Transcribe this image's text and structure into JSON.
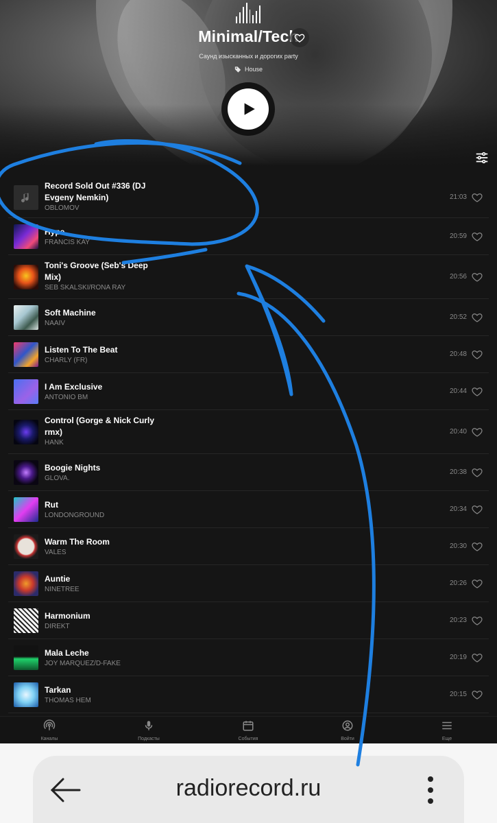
{
  "channel": {
    "title": "Minimal/Tech",
    "subtitle": "Саунд изысканных и дорогих party",
    "genre": "House"
  },
  "tracks": [
    {
      "title": "Record Sold Out #336 (DJ Evgeny Nemkin)",
      "artist": "Oblomov",
      "time": "21:03"
    },
    {
      "title": "Hype",
      "artist": "FRANCIS KAY",
      "time": "20:59"
    },
    {
      "title": "Toni's Groove (Seb's Deep Mix)",
      "artist": "SEB SKALSKI/RONA RAY",
      "time": "20:56"
    },
    {
      "title": "Soft Machine",
      "artist": "NAAIV",
      "time": "20:52"
    },
    {
      "title": "Listen To The Beat",
      "artist": "CHARLY (FR)",
      "time": "20:48"
    },
    {
      "title": "I Am Exclusive",
      "artist": "ANTONIO BM",
      "time": "20:44"
    },
    {
      "title": "Control (Gorge & Nick Curly rmx)",
      "artist": "HANK",
      "time": "20:40"
    },
    {
      "title": "Boogie Nights",
      "artist": "GLOVA.",
      "time": "20:38"
    },
    {
      "title": "Rut",
      "artist": "LONDONGROUND",
      "time": "20:34"
    },
    {
      "title": "Warm The Room",
      "artist": "VALES",
      "time": "20:30"
    },
    {
      "title": "Auntie",
      "artist": "NINETREE",
      "time": "20:26"
    },
    {
      "title": "Harmonium",
      "artist": "DIREKT",
      "time": "20:23"
    },
    {
      "title": "Mala Leche",
      "artist": "JOY MARQUEZ/D-FAKE",
      "time": "20:19"
    },
    {
      "title": "Tarkan",
      "artist": "THOMAS HEM",
      "time": "20:15"
    }
  ],
  "nav": [
    {
      "label": "Каналы",
      "icon": "podcast-icon"
    },
    {
      "label": "Подкасты",
      "icon": "microphone-icon"
    },
    {
      "label": "События",
      "icon": "calendar-icon"
    },
    {
      "label": "Войти",
      "icon": "user-icon"
    },
    {
      "label": "Еще",
      "icon": "menu-icon"
    }
  ],
  "browser": {
    "url": "radiorecord.ru"
  },
  "colors": {
    "background": "#151515",
    "annotation": "#1e7fe0"
  }
}
